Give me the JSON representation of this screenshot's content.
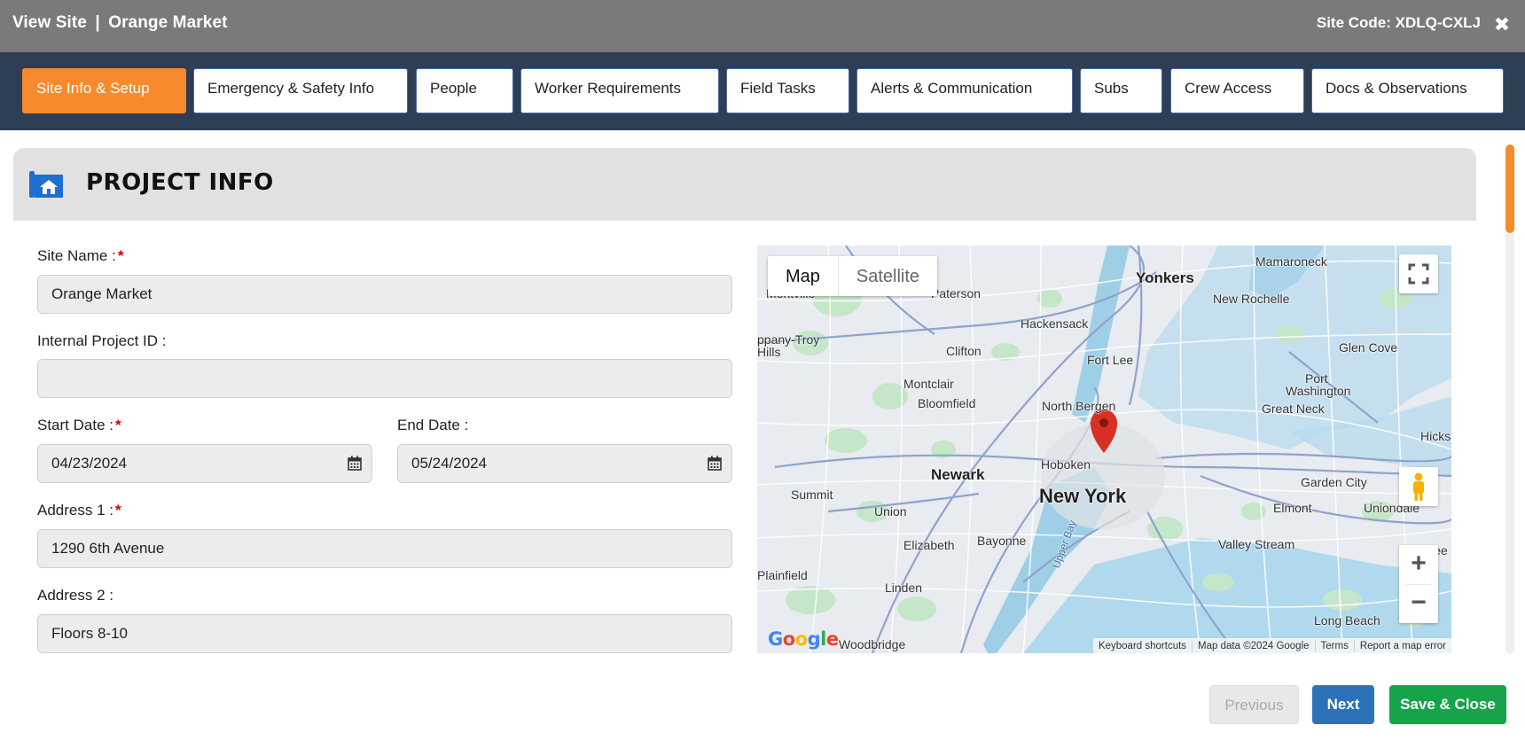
{
  "window": {
    "title_prefix": "View Site",
    "title_separator": "|",
    "site_name": "Orange Market",
    "site_code": "Site Code: XDLQ-CXLJ",
    "close_icon": "close-icon"
  },
  "tabs": [
    {
      "label": "Site Info & Setup",
      "active": true
    },
    {
      "label": "Emergency & Safety Info",
      "active": false
    },
    {
      "label": "People",
      "active": false
    },
    {
      "label": "Worker Requirements",
      "active": false
    },
    {
      "label": "Field Tasks",
      "active": false
    },
    {
      "label": "Alerts & Communication",
      "active": false
    },
    {
      "label": "Subs",
      "active": false
    },
    {
      "label": "Crew Access",
      "active": false
    },
    {
      "label": "Docs & Observations",
      "active": false
    }
  ],
  "section": {
    "title": "PROJECT INFO",
    "icon": "blueprint-house-icon"
  },
  "form": {
    "site_name": {
      "label": "Site Name :",
      "required": "*",
      "value": "Orange Market"
    },
    "internal_project_id": {
      "label": "Internal Project ID :",
      "value": ""
    },
    "start_date": {
      "label": "Start Date :",
      "required": "*",
      "value": "04/23/2024"
    },
    "end_date": {
      "label": "End Date :",
      "value": "05/24/2024"
    },
    "address1": {
      "label": "Address 1 :",
      "required": "*",
      "value": "1290 6th Avenue"
    },
    "address2": {
      "label": "Address 2 :",
      "value": "Floors 8-10"
    }
  },
  "map": {
    "type_map": "Map",
    "type_satellite": "Satellite",
    "zoom_in": "+",
    "zoom_out": "−",
    "google_logo": "Google",
    "footer": [
      "Keyboard shortcuts",
      "Map data ©2024 Google",
      "Terms",
      "Report a map error"
    ],
    "places": {
      "yonkers": "Yonkers",
      "mamaroneck": "Mamaroneck",
      "new_rochelle": "New Rochelle",
      "paterson": "Paterson",
      "montville": "Montville",
      "parsippany": "ppany-Troy",
      "hills": "Hills",
      "hackensack": "Hackensack",
      "clifton": "Clifton",
      "fort_lee": "Fort Lee",
      "glen_cove": "Glen Cove",
      "port_washington_1": "Port",
      "port_washington_2": "Washington",
      "montclair": "Montclair",
      "bloomfield": "Bloomfield",
      "north_bergen": "North Bergen",
      "great_neck": "Great Neck",
      "hicks": "Hicks",
      "newark": "Newark",
      "hoboken": "Hoboken",
      "new_york": "New York",
      "garden_city": "Garden City",
      "summit": "Summit",
      "union": "Union",
      "elmont": "Elmont",
      "uniondale": "Uniondale",
      "elizabeth": "Elizabeth",
      "bayonne": "Bayonne",
      "valley_stream": "Valley Stream",
      "free": "Free",
      "plainfield": "Plainfield",
      "linden": "Linden",
      "long_beach": "Long Beach",
      "woodbridge": "Woodbridge",
      "upper_bay": "Upper Bay"
    }
  },
  "buttons": {
    "previous": "Previous",
    "next": "Next",
    "save_close": "Save & Close"
  },
  "colors": {
    "accent": "#f78a2d",
    "nav": "#2d3e55",
    "next": "#2d72b8",
    "save": "#17a34a",
    "required": "#cc0000"
  }
}
